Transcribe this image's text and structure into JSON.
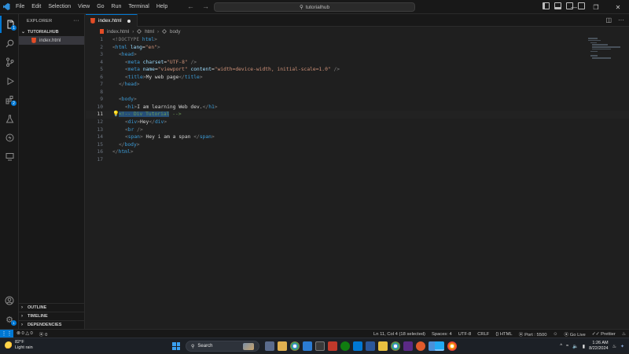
{
  "titlebar": {
    "menu": [
      "File",
      "Edit",
      "Selection",
      "View",
      "Go",
      "Run",
      "Terminal",
      "Help"
    ],
    "search_text": "tutorialhub",
    "back_icon": "arrow-left-icon",
    "forward_icon": "arrow-right-icon"
  },
  "sidebar": {
    "title": "EXPLORER",
    "folder": "TUTORIALHUB",
    "files": [
      "index.html"
    ],
    "sections": [
      "OUTLINE",
      "TIMELINE",
      "DEPENDENCIES"
    ]
  },
  "activity_badges": {
    "explorer": "1",
    "extensions": "2"
  },
  "editor": {
    "tab_label": "index.html",
    "breadcrumb": [
      "index.html",
      "html",
      "body"
    ],
    "current_line": 11,
    "lines": [
      {
        "n": "1"
      },
      {
        "n": "2"
      },
      {
        "n": "3"
      },
      {
        "n": "4"
      },
      {
        "n": "5"
      },
      {
        "n": "6"
      },
      {
        "n": "7"
      },
      {
        "n": "8"
      },
      {
        "n": "9"
      },
      {
        "n": "10"
      },
      {
        "n": "11"
      },
      {
        "n": "12"
      },
      {
        "n": "13"
      },
      {
        "n": "14"
      },
      {
        "n": "15"
      },
      {
        "n": "16"
      },
      {
        "n": "17"
      }
    ],
    "code": {
      "l1": [
        "<!DOCTYPE ",
        "html",
        ">"
      ],
      "l2": [
        "<",
        "html",
        " ",
        "lang",
        "=",
        "\"en\"",
        ">"
      ],
      "l3": [
        "<",
        "head",
        ">"
      ],
      "l4": [
        "<",
        "meta",
        " ",
        "charset",
        "=",
        "\"UTF-8\"",
        " />"
      ],
      "l5": [
        "<",
        "meta",
        " ",
        "name",
        "=",
        "\"viewport\"",
        " ",
        "content",
        "=",
        "\"width=device-width, initial-scale=1.0\"",
        " />"
      ],
      "l6": [
        "<",
        "title",
        ">",
        "My web page",
        "</",
        "title",
        ">"
      ],
      "l7": [
        "</",
        "head",
        ">"
      ],
      "l9": [
        "<",
        "body",
        ">"
      ],
      "l10": [
        "<",
        "h1",
        ">",
        "I am learning Web dev.",
        "</",
        "h1",
        ">"
      ],
      "l11_sel": "<!-- Div Tutorial",
      "l11_rest": " -->",
      "l12": [
        "<",
        "div",
        ">",
        "Hey",
        "</",
        "div",
        ">"
      ],
      "l13": [
        "<",
        "br",
        " />"
      ],
      "l14": [
        "<",
        "span",
        ">",
        " Hey i am a span ",
        "</",
        "span",
        ">"
      ],
      "l15": [
        "</",
        "body",
        ">"
      ],
      "l16": [
        "</",
        "html",
        ">"
      ]
    }
  },
  "statusbar": {
    "remote_icon": "remote-icon",
    "problems_errors": "0",
    "problems_warnings": "0",
    "ports": "0",
    "cursor": "Ln 11, Col 4 (18 selected)",
    "spaces": "Spaces: 4",
    "encoding": "UTF-8",
    "eol": "CRLF",
    "language": "HTML",
    "port": "Port : 5500",
    "go_live": "Go Live",
    "prettier": "Prettier"
  },
  "taskbar": {
    "weather_temp": "82°F",
    "weather_desc": "Light rain",
    "search_label": "Search",
    "time": "1:26 AM",
    "date": "8/22/2024",
    "tray_chevron": "^"
  },
  "colors": {
    "accent": "#0078d4",
    "tag": "#3c9cd8",
    "attr": "#9cdcfe",
    "string": "#ce9178",
    "selection": "#264f78"
  }
}
